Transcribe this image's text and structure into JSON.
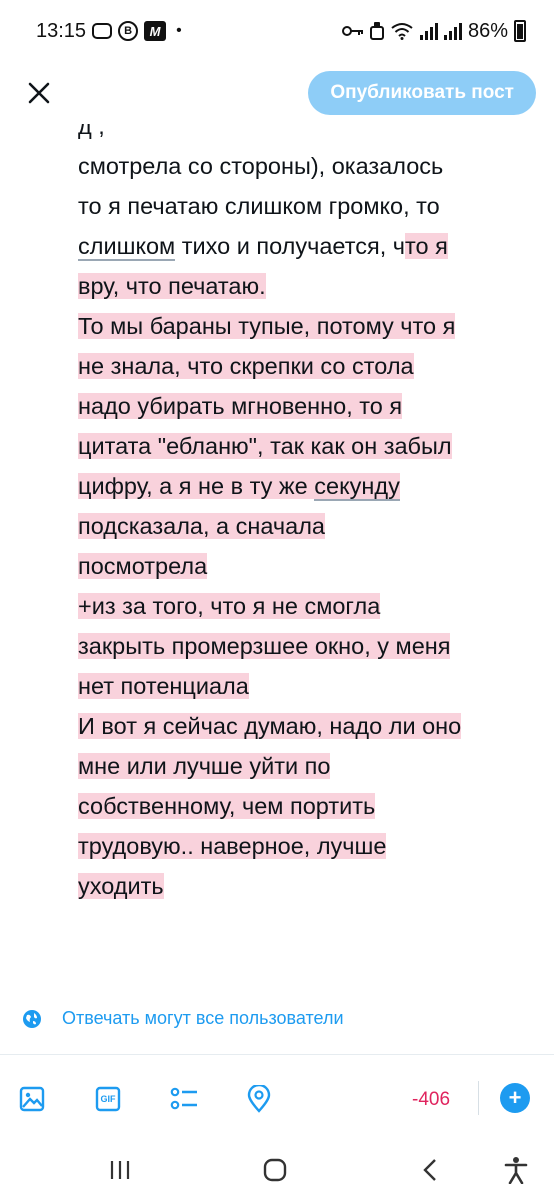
{
  "status_bar": {
    "time": "13:15",
    "battery_percent": "86%",
    "icons": [
      "pill-notification-icon",
      "b-circle-icon",
      "m-app-icon",
      "dot-icon",
      "key-icon",
      "android-icon",
      "wifi-icon",
      "signal-icon",
      "signal-icon",
      "battery-icon"
    ]
  },
  "header": {
    "close_icon": "close-icon",
    "publish_label": "Опубликовать пост"
  },
  "compose": {
    "lines": [
      {
        "text": "д                                      ,",
        "highlight": false
      },
      {
        "text": "смотрела со стороны), оказалось",
        "highlight": false
      },
      {
        "text": "то я печатаю слишком громко, то",
        "highlight": false
      },
      {
        "segments": [
          {
            "text": "слишком",
            "hl": false,
            "ul": true
          },
          {
            "text": " тихо и получается, ч",
            "hl": false
          },
          {
            "text": "то я",
            "hl": true
          }
        ]
      },
      {
        "text": "вру, что печатаю.",
        "highlight": true
      },
      {
        "text": "То мы бараны тупые, потому что я",
        "highlight": true
      },
      {
        "text": "не знала, что скрепки со стола",
        "highlight": true
      },
      {
        "text": "надо убирать мгновенно, то я",
        "highlight": true
      },
      {
        "text": "цитата \"ебланю\", так как он забыл",
        "highlight": true
      },
      {
        "segments": [
          {
            "text": "цифру, а я не в ту же ",
            "hl": true
          },
          {
            "text": "секунду",
            "hl": true,
            "ul": true
          }
        ]
      },
      {
        "text": "подсказала, а сначала",
        "highlight": true
      },
      {
        "text": "посмотрела",
        "highlight": true
      },
      {
        "text": "+из за того, что я не смогла",
        "highlight": true
      },
      {
        "text": "закрыть промерзшее окно, у меня",
        "highlight": true
      },
      {
        "text": "нет потенциала",
        "highlight": true
      },
      {
        "text": "И вот я сейчас думаю, надо ли оно",
        "highlight": true
      },
      {
        "text": "мне или лучше уйти по",
        "highlight": true
      },
      {
        "text": "собственному, чем портить",
        "highlight": true
      },
      {
        "text": "трудовую.. наверное, лучше",
        "highlight": true
      },
      {
        "text": "уходить",
        "highlight": true
      }
    ],
    "highlight_color": "#f9d2dc"
  },
  "reply_setting": {
    "icon": "globe-icon",
    "label": "Отвечать могут все пользователи"
  },
  "toolbar": {
    "icons": [
      "image-icon",
      "gif-icon",
      "poll-icon",
      "location-icon"
    ],
    "gif_label": "GIF",
    "char_counter": "-406",
    "add_icon": "add-icon"
  },
  "navbar": {
    "icons": [
      "recent-apps-icon",
      "home-icon",
      "back-icon",
      "accessibility-icon"
    ]
  },
  "colors": {
    "accent": "#1d9bf0",
    "publish_disabled": "#8ecdf7",
    "counter_over": "#e0245e"
  }
}
